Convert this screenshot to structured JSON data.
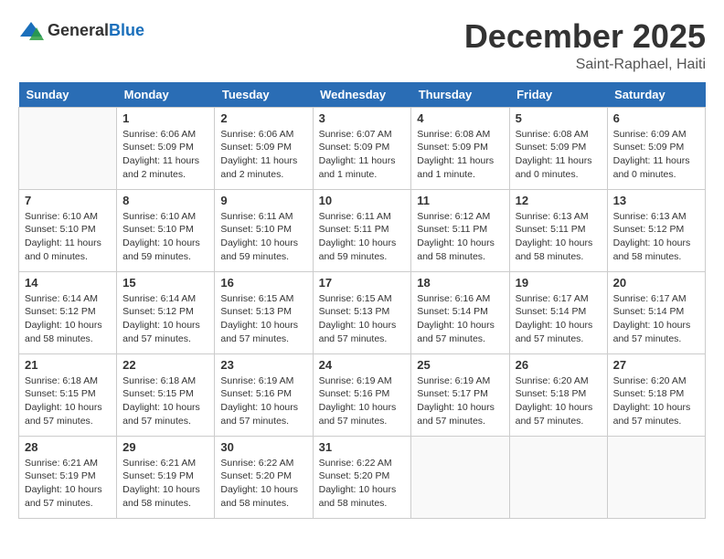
{
  "header": {
    "logo_general": "General",
    "logo_blue": "Blue",
    "month_title": "December 2025",
    "location": "Saint-Raphael, Haiti"
  },
  "days_of_week": [
    "Sunday",
    "Monday",
    "Tuesday",
    "Wednesday",
    "Thursday",
    "Friday",
    "Saturday"
  ],
  "weeks": [
    [
      {
        "day": "",
        "sunrise": "",
        "sunset": "",
        "daylight": ""
      },
      {
        "day": "1",
        "sunrise": "Sunrise: 6:06 AM",
        "sunset": "Sunset: 5:09 PM",
        "daylight": "Daylight: 11 hours and 2 minutes."
      },
      {
        "day": "2",
        "sunrise": "Sunrise: 6:06 AM",
        "sunset": "Sunset: 5:09 PM",
        "daylight": "Daylight: 11 hours and 2 minutes."
      },
      {
        "day": "3",
        "sunrise": "Sunrise: 6:07 AM",
        "sunset": "Sunset: 5:09 PM",
        "daylight": "Daylight: 11 hours and 1 minute."
      },
      {
        "day": "4",
        "sunrise": "Sunrise: 6:08 AM",
        "sunset": "Sunset: 5:09 PM",
        "daylight": "Daylight: 11 hours and 1 minute."
      },
      {
        "day": "5",
        "sunrise": "Sunrise: 6:08 AM",
        "sunset": "Sunset: 5:09 PM",
        "daylight": "Daylight: 11 hours and 0 minutes."
      },
      {
        "day": "6",
        "sunrise": "Sunrise: 6:09 AM",
        "sunset": "Sunset: 5:09 PM",
        "daylight": "Daylight: 11 hours and 0 minutes."
      }
    ],
    [
      {
        "day": "7",
        "sunrise": "Sunrise: 6:10 AM",
        "sunset": "Sunset: 5:10 PM",
        "daylight": "Daylight: 11 hours and 0 minutes."
      },
      {
        "day": "8",
        "sunrise": "Sunrise: 6:10 AM",
        "sunset": "Sunset: 5:10 PM",
        "daylight": "Daylight: 10 hours and 59 minutes."
      },
      {
        "day": "9",
        "sunrise": "Sunrise: 6:11 AM",
        "sunset": "Sunset: 5:10 PM",
        "daylight": "Daylight: 10 hours and 59 minutes."
      },
      {
        "day": "10",
        "sunrise": "Sunrise: 6:11 AM",
        "sunset": "Sunset: 5:11 PM",
        "daylight": "Daylight: 10 hours and 59 minutes."
      },
      {
        "day": "11",
        "sunrise": "Sunrise: 6:12 AM",
        "sunset": "Sunset: 5:11 PM",
        "daylight": "Daylight: 10 hours and 58 minutes."
      },
      {
        "day": "12",
        "sunrise": "Sunrise: 6:13 AM",
        "sunset": "Sunset: 5:11 PM",
        "daylight": "Daylight: 10 hours and 58 minutes."
      },
      {
        "day": "13",
        "sunrise": "Sunrise: 6:13 AM",
        "sunset": "Sunset: 5:12 PM",
        "daylight": "Daylight: 10 hours and 58 minutes."
      }
    ],
    [
      {
        "day": "14",
        "sunrise": "Sunrise: 6:14 AM",
        "sunset": "Sunset: 5:12 PM",
        "daylight": "Daylight: 10 hours and 58 minutes."
      },
      {
        "day": "15",
        "sunrise": "Sunrise: 6:14 AM",
        "sunset": "Sunset: 5:12 PM",
        "daylight": "Daylight: 10 hours and 57 minutes."
      },
      {
        "day": "16",
        "sunrise": "Sunrise: 6:15 AM",
        "sunset": "Sunset: 5:13 PM",
        "daylight": "Daylight: 10 hours and 57 minutes."
      },
      {
        "day": "17",
        "sunrise": "Sunrise: 6:15 AM",
        "sunset": "Sunset: 5:13 PM",
        "daylight": "Daylight: 10 hours and 57 minutes."
      },
      {
        "day": "18",
        "sunrise": "Sunrise: 6:16 AM",
        "sunset": "Sunset: 5:14 PM",
        "daylight": "Daylight: 10 hours and 57 minutes."
      },
      {
        "day": "19",
        "sunrise": "Sunrise: 6:17 AM",
        "sunset": "Sunset: 5:14 PM",
        "daylight": "Daylight: 10 hours and 57 minutes."
      },
      {
        "day": "20",
        "sunrise": "Sunrise: 6:17 AM",
        "sunset": "Sunset: 5:14 PM",
        "daylight": "Daylight: 10 hours and 57 minutes."
      }
    ],
    [
      {
        "day": "21",
        "sunrise": "Sunrise: 6:18 AM",
        "sunset": "Sunset: 5:15 PM",
        "daylight": "Daylight: 10 hours and 57 minutes."
      },
      {
        "day": "22",
        "sunrise": "Sunrise: 6:18 AM",
        "sunset": "Sunset: 5:15 PM",
        "daylight": "Daylight: 10 hours and 57 minutes."
      },
      {
        "day": "23",
        "sunrise": "Sunrise: 6:19 AM",
        "sunset": "Sunset: 5:16 PM",
        "daylight": "Daylight: 10 hours and 57 minutes."
      },
      {
        "day": "24",
        "sunrise": "Sunrise: 6:19 AM",
        "sunset": "Sunset: 5:16 PM",
        "daylight": "Daylight: 10 hours and 57 minutes."
      },
      {
        "day": "25",
        "sunrise": "Sunrise: 6:19 AM",
        "sunset": "Sunset: 5:17 PM",
        "daylight": "Daylight: 10 hours and 57 minutes."
      },
      {
        "day": "26",
        "sunrise": "Sunrise: 6:20 AM",
        "sunset": "Sunset: 5:18 PM",
        "daylight": "Daylight: 10 hours and 57 minutes."
      },
      {
        "day": "27",
        "sunrise": "Sunrise: 6:20 AM",
        "sunset": "Sunset: 5:18 PM",
        "daylight": "Daylight: 10 hours and 57 minutes."
      }
    ],
    [
      {
        "day": "28",
        "sunrise": "Sunrise: 6:21 AM",
        "sunset": "Sunset: 5:19 PM",
        "daylight": "Daylight: 10 hours and 57 minutes."
      },
      {
        "day": "29",
        "sunrise": "Sunrise: 6:21 AM",
        "sunset": "Sunset: 5:19 PM",
        "daylight": "Daylight: 10 hours and 58 minutes."
      },
      {
        "day": "30",
        "sunrise": "Sunrise: 6:22 AM",
        "sunset": "Sunset: 5:20 PM",
        "daylight": "Daylight: 10 hours and 58 minutes."
      },
      {
        "day": "31",
        "sunrise": "Sunrise: 6:22 AM",
        "sunset": "Sunset: 5:20 PM",
        "daylight": "Daylight: 10 hours and 58 minutes."
      },
      {
        "day": "",
        "sunrise": "",
        "sunset": "",
        "daylight": ""
      },
      {
        "day": "",
        "sunrise": "",
        "sunset": "",
        "daylight": ""
      },
      {
        "day": "",
        "sunrise": "",
        "sunset": "",
        "daylight": ""
      }
    ]
  ]
}
